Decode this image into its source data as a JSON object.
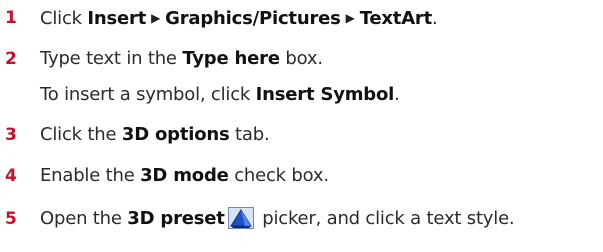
{
  "steps": [
    {
      "num": "1",
      "parts": {
        "p1": "Click ",
        "b1": "Insert",
        "b2": "Graphics/Pictures",
        "b3": "TextArt",
        "p2": "."
      }
    },
    {
      "num": "2",
      "parts": {
        "p1": "Type text in the ",
        "b1": "Type here",
        "p2": " box."
      }
    },
    {
      "num": "",
      "parts": {
        "p1": "To insert a symbol, click ",
        "b1": "Insert Symbol",
        "p2": "."
      }
    },
    {
      "num": "3",
      "parts": {
        "p1": "Click the ",
        "b1": "3D options",
        "p2": " tab."
      }
    },
    {
      "num": "4",
      "parts": {
        "p1": "Enable the ",
        "b1": "3D mode",
        "p2": " check box."
      }
    },
    {
      "num": "5",
      "parts": {
        "p1": "Open the ",
        "b1": "3D preset",
        "p2": " picker, and click a text style."
      }
    }
  ],
  "icons": {
    "menu_arrow": "▶",
    "preset_icon": "3d-preset-icon"
  },
  "colors": {
    "step_number": "#c8102e",
    "icon_blue": "#1b52c4"
  }
}
